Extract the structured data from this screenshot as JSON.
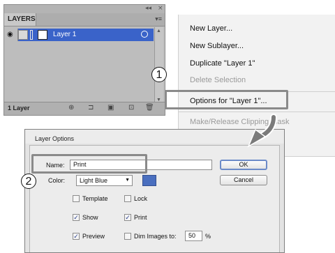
{
  "layers_panel": {
    "tab_label": "LAYERS",
    "collapse_glyph": "◂◂",
    "close_glyph": "×",
    "menu_glyph": "▾≡",
    "layer_name": "Layer 1",
    "layer_count": "1 Layer",
    "footer_icons": [
      "locate-object-icon",
      "make-clipping-mask-icon",
      "new-sublayer-icon",
      "new-layer-icon",
      "trash-icon"
    ]
  },
  "flyout_menu": {
    "new_layer": "New Layer...",
    "new_sublayer": "New Sublayer...",
    "duplicate": "Duplicate \"Layer 1\"",
    "delete_selection": "Delete Selection",
    "options": "Options for \"Layer 1\"...",
    "make_release": "Make/Release Clipping Mask"
  },
  "callouts": {
    "one": "1",
    "two": "2"
  },
  "dialog": {
    "title": "Layer Options",
    "name_label": "Name:",
    "name_value": "Print",
    "color_label": "Color:",
    "color_value": "Light Blue",
    "color_swatch": "#4a6fbf",
    "ok": "OK",
    "cancel": "Cancel",
    "template": "Template",
    "lock": "Lock",
    "show": "Show",
    "print": "Print",
    "preview": "Preview",
    "dim_images": "Dim Images to:",
    "dim_value": "50",
    "percent": "%",
    "checked": {
      "template": false,
      "lock": false,
      "show": true,
      "print": true,
      "preview": true,
      "dim": false
    }
  },
  "colors": {
    "selection_blue": "#3a63c9",
    "highlight_frame": "#8a8a8a"
  }
}
